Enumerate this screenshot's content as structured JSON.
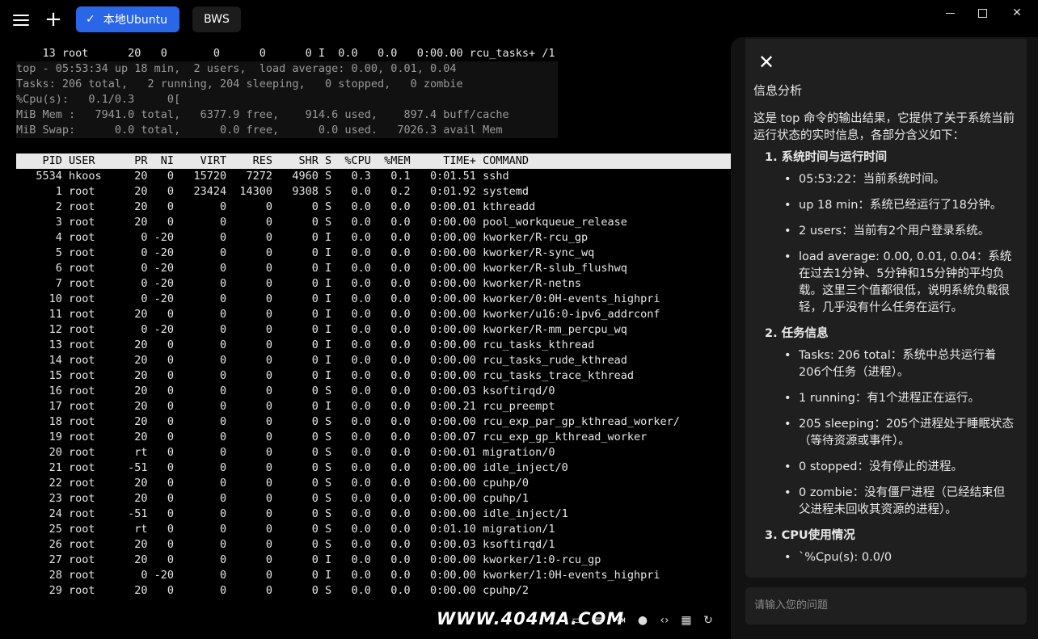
{
  "tabs": [
    {
      "label": "本地Ubuntu",
      "active": true
    },
    {
      "label": "BWS",
      "active": false
    }
  ],
  "terminal": {
    "prev_line": "    13 root      20   0       0      0      0 I  0.0   0.0   0:00.00 rcu_tasks+ /1",
    "summary": [
      "top - 05:53:34 up 18 min,  2 users,  load average: 0.00, 0.01, 0.04",
      "Tasks: 206 total,   2 running, 204 sleeping,   0 stopped,   0 zombie",
      "%Cpu(s):   0.1/0.3     0[",
      "MiB Mem :   7941.0 total,   6377.9 free,    914.6 used,    897.4 buff/cache",
      "MiB Swap:      0.0 total,      0.0 free,      0.0 used.   7026.3 avail Mem"
    ],
    "header": "    PID USER      PR  NI    VIRT    RES    SHR S  %CPU  %MEM     TIME+ COMMAND",
    "rows": [
      "   5534 hkoos     20   0   15720   7272   4960 S   0.3   0.1   0:01.51 sshd",
      "      1 root      20   0   23424  14300   9308 S   0.0   0.2   0:01.92 systemd",
      "      2 root      20   0       0      0      0 S   0.0   0.0   0:00.01 kthreadd",
      "      3 root      20   0       0      0      0 S   0.0   0.0   0:00.00 pool_workqueue_release",
      "      4 root       0 -20       0      0      0 I   0.0   0.0   0:00.00 kworker/R-rcu_gp",
      "      5 root       0 -20       0      0      0 I   0.0   0.0   0:00.00 kworker/R-sync_wq",
      "      6 root       0 -20       0      0      0 I   0.0   0.0   0:00.00 kworker/R-slub_flushwq",
      "      7 root       0 -20       0      0      0 I   0.0   0.0   0:00.00 kworker/R-netns",
      "     10 root       0 -20       0      0      0 I   0.0   0.0   0:00.00 kworker/0:0H-events_highpri",
      "     11 root      20   0       0      0      0 I   0.0   0.0   0:00.00 kworker/u16:0-ipv6_addrconf",
      "     12 root       0 -20       0      0      0 I   0.0   0.0   0:00.00 kworker/R-mm_percpu_wq",
      "     13 root      20   0       0      0      0 I   0.0   0.0   0:00.00 rcu_tasks_kthread",
      "     14 root      20   0       0      0      0 I   0.0   0.0   0:00.00 rcu_tasks_rude_kthread",
      "     15 root      20   0       0      0      0 I   0.0   0.0   0:00.00 rcu_tasks_trace_kthread",
      "     16 root      20   0       0      0      0 S   0.0   0.0   0:00.03 ksoftirqd/0",
      "     17 root      20   0       0      0      0 I   0.0   0.0   0:00.21 rcu_preempt",
      "     18 root      20   0       0      0      0 S   0.0   0.0   0:00.00 rcu_exp_par_gp_kthread_worker/",
      "     19 root      20   0       0      0      0 S   0.0   0.0   0:00.07 rcu_exp_gp_kthread_worker",
      "     20 root      rt   0       0      0      0 S   0.0   0.0   0:00.01 migration/0",
      "     21 root     -51   0       0      0      0 S   0.0   0.0   0:00.00 idle_inject/0",
      "     22 root      20   0       0      0      0 S   0.0   0.0   0:00.00 cpuhp/0",
      "     23 root      20   0       0      0      0 S   0.0   0.0   0:00.00 cpuhp/1",
      "     24 root     -51   0       0      0      0 S   0.0   0.0   0:00.00 idle_inject/1",
      "     25 root      rt   0       0      0      0 S   0.0   0.0   0:01.10 migration/1",
      "     26 root      20   0       0      0      0 S   0.0   0.0   0:00.03 ksoftirqd/1",
      "     27 root      20   0       0      0      0 I   0.0   0.0   0:00.00 kworker/1:0-rcu_gp",
      "     28 root       0 -20       0      0      0 I   0.0   0.0   0:00.00 kworker/1:0H-events_highpri",
      "     29 root      20   0       0      0      0 S   0.0   0.0   0:00.00 cpuhp/2"
    ]
  },
  "panel": {
    "title": "信息分析",
    "intro": "这是 top 命令的输出结果，它提供了关于系统当前运行状态的实时信息，各部分含义如下：",
    "sections": [
      {
        "heading": "1. 系统时间与运行时间",
        "bullets": [
          "05:53:22：当前系统时间。",
          "up 18 min：系统已经运行了18分钟。",
          "2 users：当前有2个用户登录系统。",
          "load average: 0.00, 0.01, 0.04：系统在过去1分钟、5分钟和15分钟的平均负载。这里三个值都很低，说明系统负载很轻，几乎没有什么任务在运行。"
        ]
      },
      {
        "heading": "2. 任务信息",
        "bullets": [
          "Tasks: 206 total：系统中总共运行着206个任务（进程）。",
          "1 running：有1个进程正在运行。",
          "205 sleeping：205个进程处于睡眠状态（等待资源或事件）。",
          "0 stopped：没有停止的进程。",
          "0 zombie：没有僵尸进程（已经结束但父进程未回收其资源的进程）。"
        ]
      },
      {
        "heading": "3. CPU使用情况",
        "bullets": [
          "`%Cpu(s): 0.0/0"
        ]
      }
    ],
    "input_placeholder": "请输入您的问题"
  },
  "watermark": "WWW.404MA.COM",
  "toolbar_icons": [
    "terminal-icon",
    "format-icon",
    "split-icon",
    "bulb-icon",
    "code-icon",
    "keyboard-icon",
    "refresh-icon"
  ],
  "colors": {
    "accent": "#2a66e8"
  }
}
